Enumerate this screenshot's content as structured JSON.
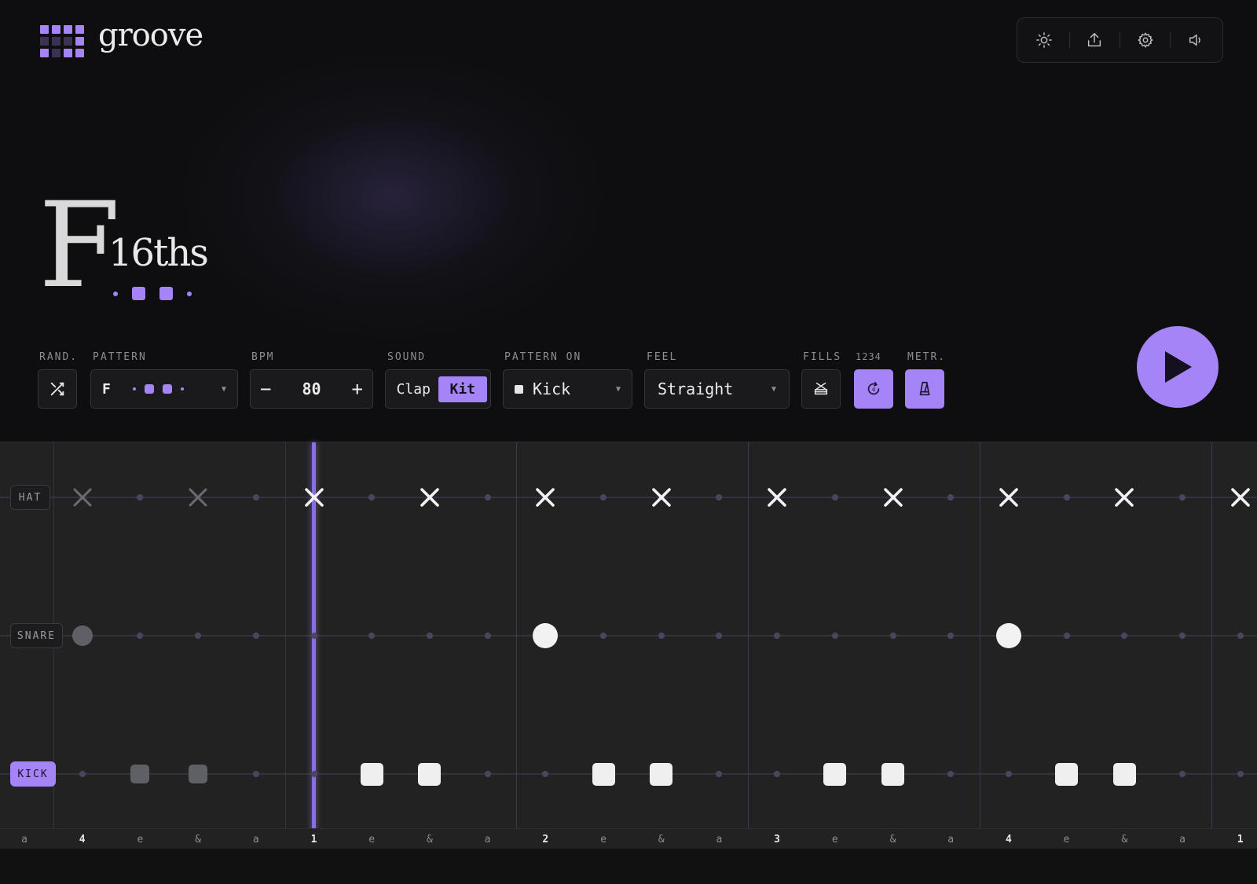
{
  "app": {
    "brand": "groove",
    "accent_color": "#a584f7"
  },
  "logo_grid": [
    1,
    1,
    1,
    1,
    0,
    0,
    0,
    1,
    1,
    0,
    1,
    1
  ],
  "toolbar": {
    "icons": [
      "sun-icon",
      "share-icon",
      "gear-icon",
      "speaker-icon"
    ]
  },
  "pattern_title": {
    "letter": "F",
    "subdivision": "16ths",
    "dots": [
      "small",
      "big",
      "big",
      "small"
    ]
  },
  "controls": {
    "rand_label": "RAND.",
    "pattern_label": "PATTERN",
    "pattern_value": "F",
    "bpm_label": "BPM",
    "bpm_value": "80",
    "bpm_minus": "−",
    "bpm_plus": "+",
    "sound_label": "SOUND",
    "sound_options": [
      "Clap",
      "Kit"
    ],
    "sound_selected": "Kit",
    "pattern_on_label": "PATTERN ON",
    "pattern_on_value": "Kick",
    "feel_label": "FEEL",
    "feel_value": "Straight",
    "fills_label": "FILLS",
    "count_label": "1234",
    "metr_label": "METR."
  },
  "sequencer": {
    "rows": [
      {
        "name": "HAT",
        "active": false
      },
      {
        "name": "SNARE",
        "active": false
      },
      {
        "name": "KICK",
        "active": true
      }
    ],
    "steps": [
      {
        "count": "a",
        "beat": false,
        "hat": "none",
        "snare": "none",
        "kick": "none"
      },
      {
        "count": "4",
        "beat": true,
        "hat": "x-ghost",
        "snare": "ghost",
        "kick": "dot"
      },
      {
        "count": "e",
        "beat": false,
        "hat": "dot",
        "snare": "dot",
        "kick": "ghost"
      },
      {
        "count": "&",
        "beat": false,
        "hat": "x-ghost",
        "snare": "dot",
        "kick": "ghost"
      },
      {
        "count": "a",
        "beat": false,
        "hat": "dot",
        "snare": "dot",
        "kick": "dot"
      },
      {
        "count": "1",
        "beat": true,
        "hat": "x",
        "snare": "dot",
        "kick": "dot"
      },
      {
        "count": "e",
        "beat": false,
        "hat": "dot",
        "snare": "dot",
        "kick": "on"
      },
      {
        "count": "&",
        "beat": false,
        "hat": "x",
        "snare": "dot",
        "kick": "on"
      },
      {
        "count": "a",
        "beat": false,
        "hat": "dot",
        "snare": "dot",
        "kick": "dot"
      },
      {
        "count": "2",
        "beat": true,
        "hat": "x",
        "snare": "on",
        "kick": "dot"
      },
      {
        "count": "e",
        "beat": false,
        "hat": "dot",
        "snare": "dot",
        "kick": "on"
      },
      {
        "count": "&",
        "beat": false,
        "hat": "x",
        "snare": "dot",
        "kick": "on"
      },
      {
        "count": "a",
        "beat": false,
        "hat": "dot",
        "snare": "dot",
        "kick": "dot"
      },
      {
        "count": "3",
        "beat": true,
        "hat": "x",
        "snare": "dot",
        "kick": "dot"
      },
      {
        "count": "e",
        "beat": false,
        "hat": "dot",
        "snare": "dot",
        "kick": "on"
      },
      {
        "count": "&",
        "beat": false,
        "hat": "x",
        "snare": "dot",
        "kick": "on"
      },
      {
        "count": "a",
        "beat": false,
        "hat": "dot",
        "snare": "dot",
        "kick": "dot"
      },
      {
        "count": "4",
        "beat": true,
        "hat": "x",
        "snare": "on",
        "kick": "dot"
      },
      {
        "count": "e",
        "beat": false,
        "hat": "dot",
        "snare": "dot",
        "kick": "on"
      },
      {
        "count": "&",
        "beat": false,
        "hat": "x",
        "snare": "dot",
        "kick": "on"
      },
      {
        "count": "a",
        "beat": false,
        "hat": "dot",
        "snare": "dot",
        "kick": "dot"
      },
      {
        "count": "1",
        "beat": true,
        "hat": "x",
        "snare": "dot",
        "kick": "dot"
      }
    ],
    "playhead_step": 5
  }
}
